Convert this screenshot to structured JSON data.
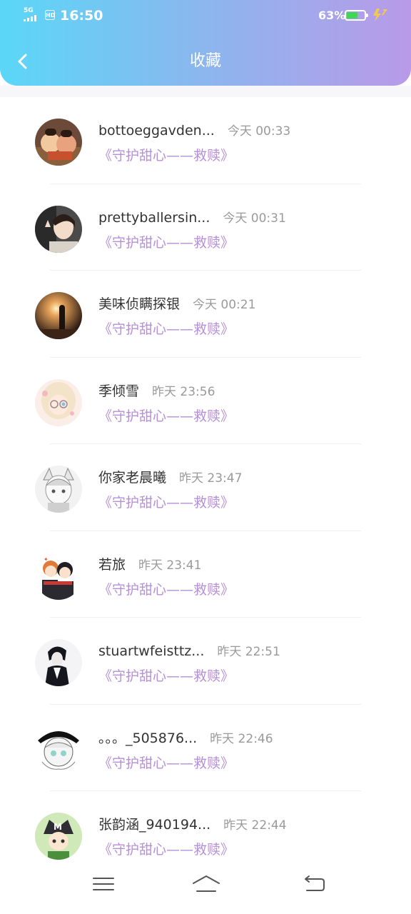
{
  "status_bar": {
    "network": "5G",
    "hd": "HD",
    "time": "16:50",
    "battery_percent": "63%",
    "battery_level": 0.63,
    "battery_color": "#45d45a",
    "charging_color": "#f2c94c"
  },
  "header": {
    "title": "收藏",
    "back_icon": "chevron-left-icon",
    "gradient": [
      "#5ad7f7",
      "#b99ae8"
    ]
  },
  "favorites": [
    {
      "name": "bottoeggavden...",
      "time": "今天 00:33",
      "title": "《守护甜心——救赎》"
    },
    {
      "name": "prettyballersin...",
      "time": "今天 00:31",
      "title": "《守护甜心——救赎》"
    },
    {
      "name": "美味侦瞒探银",
      "time": "今天 00:21",
      "title": "《守护甜心——救赎》"
    },
    {
      "name": "季倾雪",
      "time": "昨天 23:56",
      "title": "《守护甜心——救赎》"
    },
    {
      "name": "你家老晨曦",
      "time": "昨天 23:47",
      "title": "《守护甜心——救赎》"
    },
    {
      "name": "若旅",
      "time": "昨天 23:41",
      "title": "《守护甜心——救赎》"
    },
    {
      "name": "stuartwfeisttz...",
      "time": "昨天 22:51",
      "title": "《守护甜心——救赎》"
    },
    {
      "name": "。。。_505876...",
      "time": "昨天 22:46",
      "title": "《守护甜心——救赎》"
    },
    {
      "name": "张韵涵_940194...",
      "time": "昨天 22:44",
      "title": "《守护甜心——救赎》"
    }
  ],
  "nav": {
    "menu_icon": "menu-icon",
    "home_icon": "home-icon",
    "back_icon": "back-arrow-icon"
  },
  "colors": {
    "accent_link": "#b690d8",
    "name_text": "#333333",
    "time_text": "#9a9a9a"
  }
}
